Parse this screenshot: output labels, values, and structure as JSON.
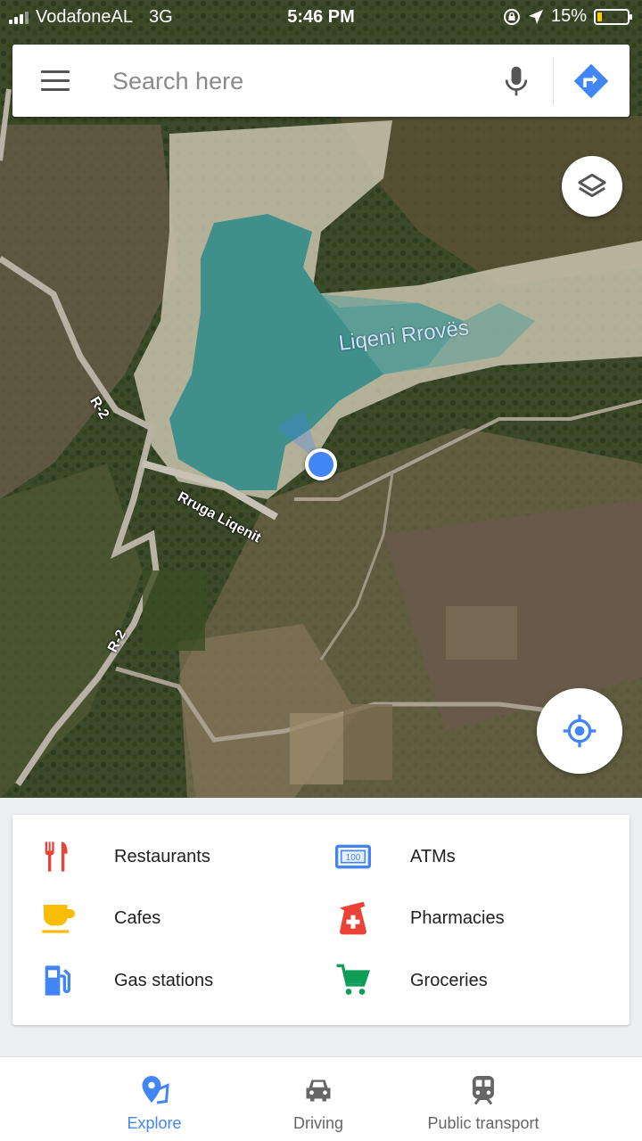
{
  "status": {
    "carrier": "VodafoneAL",
    "network": "3G",
    "time": "5:46 PM",
    "battery_percent": "15%",
    "battery_level": 0.15,
    "icons": [
      "signal-icon",
      "rotation-lock-icon",
      "location-arrow-icon",
      "battery-icon"
    ]
  },
  "search": {
    "placeholder": "Search here",
    "icons": [
      "menu-icon",
      "mic-icon",
      "directions-icon"
    ]
  },
  "map": {
    "lake_label": "Liqeni Rrovës",
    "road_label": "Rruga Liqenit",
    "route_label_1": "R-2",
    "route_label_2": "R-2",
    "icons": [
      "layers-icon",
      "my-location-icon"
    ]
  },
  "explore": {
    "categories": [
      {
        "label": "Restaurants",
        "icon": "restaurant-icon",
        "color": "#ea4335"
      },
      {
        "label": "ATMs",
        "icon": "atm-icon",
        "color": "#4285f4"
      },
      {
        "label": "Cafes",
        "icon": "cafe-icon",
        "color": "#fbbc04"
      },
      {
        "label": "Pharmacies",
        "icon": "pharmacy-icon",
        "color": "#ea4335"
      },
      {
        "label": "Gas stations",
        "icon": "gas-station-icon",
        "color": "#4285f4"
      },
      {
        "label": "Groceries",
        "icon": "grocery-icon",
        "color": "#0f9d58"
      }
    ]
  },
  "nav": {
    "items": [
      {
        "label": "Explore",
        "icon": "explore-icon",
        "active": true
      },
      {
        "label": "Driving",
        "icon": "car-icon",
        "active": false
      },
      {
        "label": "Public transport",
        "icon": "train-icon",
        "active": false
      }
    ]
  },
  "colors": {
    "accent": "#4285f4",
    "lake": "#3f8f8a"
  }
}
